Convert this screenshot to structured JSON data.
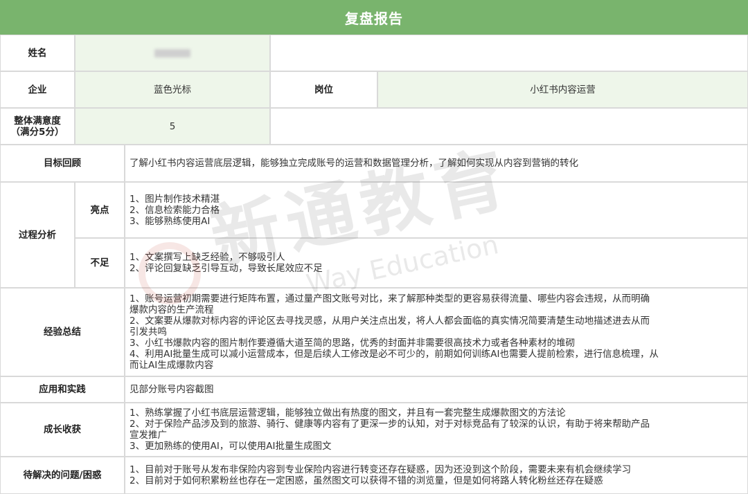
{
  "header": {
    "title": "复盘报告"
  },
  "info": {
    "name_label": "姓名",
    "company_label": "企业",
    "company_value": "蓝色光标",
    "position_label": "岗位",
    "position_value": "小红书内容运营",
    "satisfaction_label_line1": "整体满意度",
    "satisfaction_label_line2": "（满分5分）",
    "satisfaction_value": "5"
  },
  "goal": {
    "label": "目标回顾",
    "text": "了解小红书内容运营底层逻辑，能够独立完成账号的运营和数据管理分析，了解如何实现从内容到营销的转化"
  },
  "process": {
    "label": "过程分析",
    "highlights_label": "亮点",
    "highlights": [
      "1、图片制作技术精湛",
      "2、信息检索能力合格",
      "3、能够熟练使用AI"
    ],
    "shortcomings_label": "不足",
    "shortcomings": [
      "1、文案撰写上缺乏经验，不够吸引人",
      "2、评论回复缺乏引导互动，导致长尾效应不足"
    ]
  },
  "experience": {
    "label": "经验总结",
    "lines": [
      "1、账号运营初期需要进行矩阵布置，通过量产图文账号对比，来了解那种类型的更容易获得流量、哪些内容会违规，从而明确",
      "爆款内容的生产流程",
      "2、文案要从爆款对标内容的评论区去寻找灵感，从用户关注点出发，将人人都会面临的真实情况简要清楚生动地描述进去从而",
      "引发共鸣",
      "3、小红书爆款内容的图片制作要遵循大道至简的思路，优秀的封面并非需要很高技术力或者各种素材的堆砌",
      "4、利用AI批量生成可以减小运营成本，但是后续人工修改是必不可少的，前期如何训练AI也需要人提前检索，进行信息梳理，从",
      "而让AI生成爆款内容"
    ]
  },
  "practice": {
    "label": "应用和实践",
    "text": "见部分账号内容截图"
  },
  "growth": {
    "label": "成长收获",
    "lines": [
      "1、熟练掌握了小红书底层运营逻辑，能够独立做出有热度的图文，并且有一套完整生成爆款图文的方法论",
      "2、对于保险产品涉及到的旅游、骑行、健康等内容有了更深一步的认知，对于对标竞品有了较深的认识，有助于将来帮助产品",
      "宣发推广",
      "3、更加熟练的使用AI，可以使用AI批量生成图文"
    ]
  },
  "issues": {
    "label": "待解决的问题/困惑",
    "lines": [
      "1、目前对于账号从发布非保险内容到专业保险内容进行转变还存在疑惑，因为还没到这个阶段，需要未来有机会继续学习",
      "2、目前对于如何积累粉丝也存在一定困惑，虽然图文可以获得不错的浏览量，但是如何将路人转化粉丝还存在疑惑"
    ]
  },
  "watermark": {
    "cn": "新通教育",
    "en": "Way Education"
  },
  "colors": {
    "header": "#79b46d",
    "green_cell": "#eef6ea",
    "border": "#d9d9d9"
  }
}
